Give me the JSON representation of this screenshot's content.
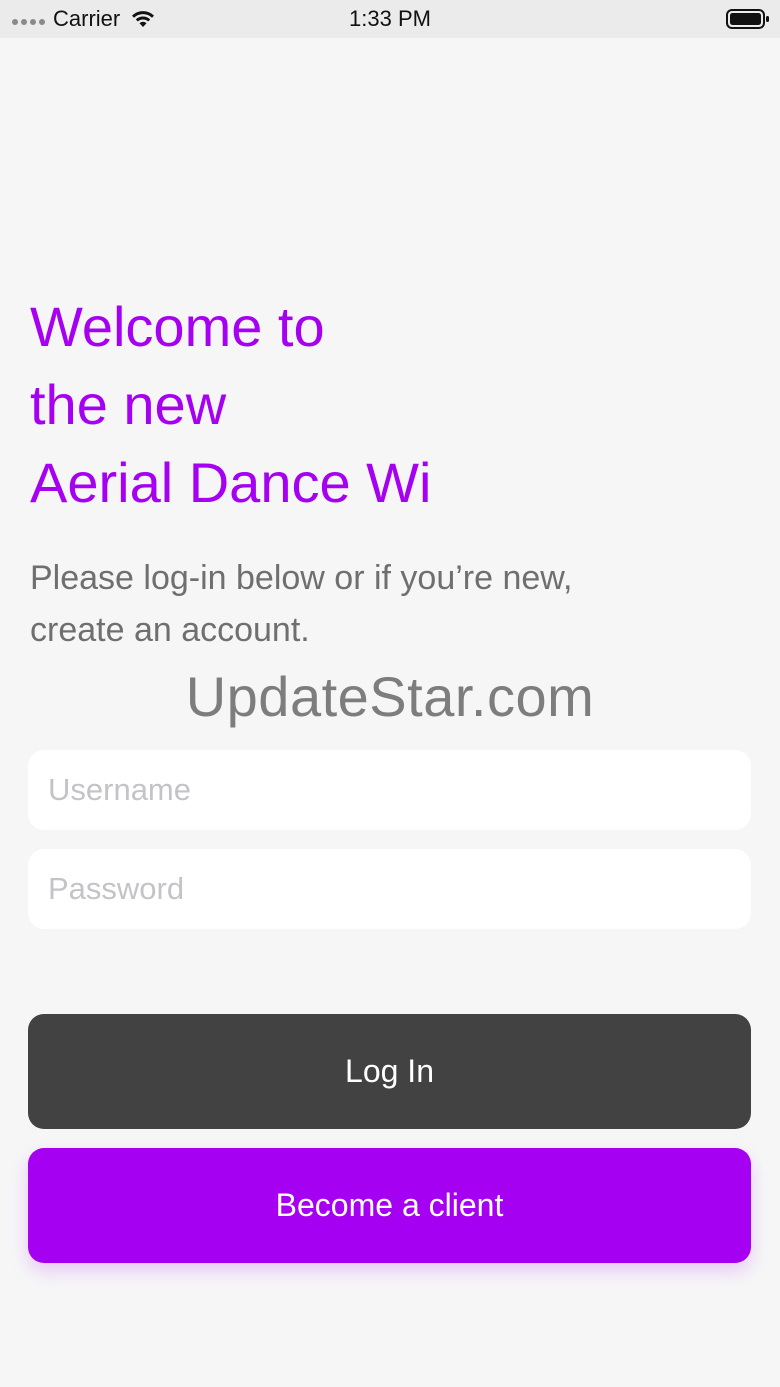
{
  "status_bar": {
    "carrier": "Carrier",
    "time": "1:33 PM",
    "icons": [
      "signal-dots-icon",
      "wifi-icon",
      "battery-icon"
    ]
  },
  "welcome": {
    "line1": "Welcome to",
    "line2": "the new",
    "line3": "Aerial Dance Wi"
  },
  "subtitle": {
    "line1": "Please log-in below or if you’re new,",
    "line2": "create an account."
  },
  "watermark": "UpdateStar.com",
  "form": {
    "username_placeholder": "Username",
    "password_placeholder": "Password"
  },
  "buttons": {
    "login_label": "Log In",
    "client_label": "Become a client"
  },
  "colors": {
    "accent": "#a600f2",
    "login_button": "#424242",
    "background": "#f6f6f7"
  }
}
